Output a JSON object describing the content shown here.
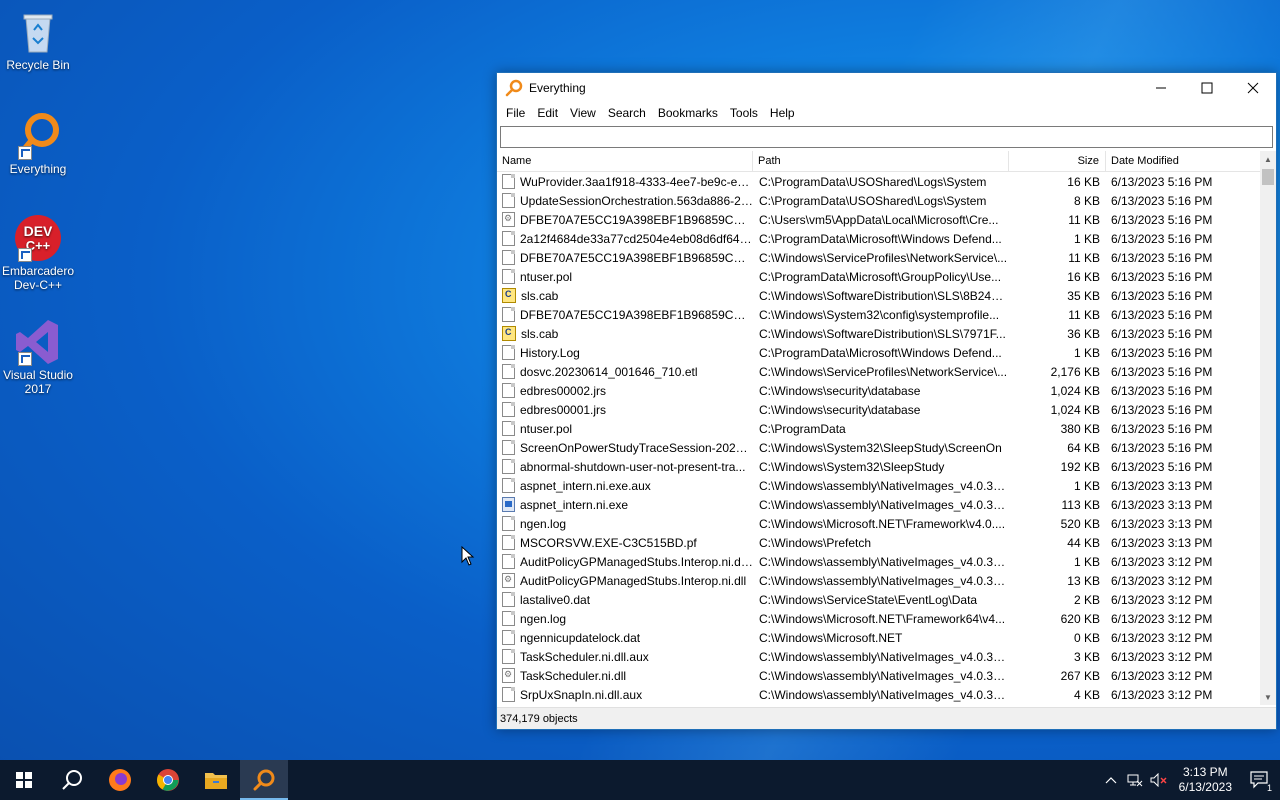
{
  "desktop": {
    "icons": [
      {
        "label": "Recycle Bin"
      },
      {
        "label": "Everything"
      },
      {
        "label": "Embarcadero Dev-C++"
      },
      {
        "label": "Visual Studio 2017"
      }
    ]
  },
  "window": {
    "title": "Everything",
    "menu": [
      "File",
      "Edit",
      "View",
      "Search",
      "Bookmarks",
      "Tools",
      "Help"
    ],
    "search": {
      "value": "",
      "placeholder": ""
    },
    "columns": {
      "name": "Name",
      "path": "Path",
      "size": "Size",
      "date": "Date Modified"
    },
    "rows": [
      {
        "icon": "doc-icon",
        "name": "WuProvider.3aa1f918-4333-4ee7-be9c-e5a...",
        "path": "C:\\ProgramData\\USOShared\\Logs\\System",
        "size": "16 KB",
        "date": "6/13/2023 5:16 PM"
      },
      {
        "icon": "doc-icon",
        "name": "UpdateSessionOrchestration.563da886-21...",
        "path": "C:\\ProgramData\\USOShared\\Logs\\System",
        "size": "8 KB",
        "date": "6/13/2023 5:16 PM"
      },
      {
        "icon": "dll-icon",
        "name": "DFBE70A7E5CC19A398EBF1B96859CE5D",
        "path": "C:\\Users\\vm5\\AppData\\Local\\Microsoft\\Cre...",
        "size": "11 KB",
        "date": "6/13/2023 5:16 PM"
      },
      {
        "icon": "doc-icon",
        "name": "2a12f4684de33a77cd2504e4eb08d6df649b...",
        "path": "C:\\ProgramData\\Microsoft\\Windows Defend...",
        "size": "1 KB",
        "date": "6/13/2023 5:16 PM"
      },
      {
        "icon": "doc-icon",
        "name": "DFBE70A7E5CC19A398EBF1B96859CE5D",
        "path": "C:\\Windows\\ServiceProfiles\\NetworkService\\...",
        "size": "11 KB",
        "date": "6/13/2023 5:16 PM"
      },
      {
        "icon": "doc-icon",
        "name": "ntuser.pol",
        "path": "C:\\ProgramData\\Microsoft\\GroupPolicy\\Use...",
        "size": "16 KB",
        "date": "6/13/2023 5:16 PM"
      },
      {
        "icon": "cab-icon",
        "name": "sls.cab",
        "path": "C:\\Windows\\SoftwareDistribution\\SLS\\8B24B...",
        "size": "35 KB",
        "date": "6/13/2023 5:16 PM"
      },
      {
        "icon": "doc-icon",
        "name": "DFBE70A7E5CC19A398EBF1B96859CE5D",
        "path": "C:\\Windows\\System32\\config\\systemprofile...",
        "size": "11 KB",
        "date": "6/13/2023 5:16 PM"
      },
      {
        "icon": "cab-icon",
        "name": "sls.cab",
        "path": "C:\\Windows\\SoftwareDistribution\\SLS\\7971F...",
        "size": "36 KB",
        "date": "6/13/2023 5:16 PM"
      },
      {
        "icon": "doc-icon",
        "name": "History.Log",
        "path": "C:\\ProgramData\\Microsoft\\Windows Defend...",
        "size": "1 KB",
        "date": "6/13/2023 5:16 PM"
      },
      {
        "icon": "doc-icon",
        "name": "dosvc.20230614_001646_710.etl",
        "path": "C:\\Windows\\ServiceProfiles\\NetworkService\\...",
        "size": "2,176 KB",
        "date": "6/13/2023 5:16 PM"
      },
      {
        "icon": "doc-icon",
        "name": "edbres00002.jrs",
        "path": "C:\\Windows\\security\\database",
        "size": "1,024 KB",
        "date": "6/13/2023 5:16 PM"
      },
      {
        "icon": "doc-icon",
        "name": "edbres00001.jrs",
        "path": "C:\\Windows\\security\\database",
        "size": "1,024 KB",
        "date": "6/13/2023 5:16 PM"
      },
      {
        "icon": "doc-icon",
        "name": "ntuser.pol",
        "path": "C:\\ProgramData",
        "size": "380 KB",
        "date": "6/13/2023 5:16 PM"
      },
      {
        "icon": "doc-icon",
        "name": "ScreenOnPowerStudyTraceSession-2023-0...",
        "path": "C:\\Windows\\System32\\SleepStudy\\ScreenOn",
        "size": "64 KB",
        "date": "6/13/2023 5:16 PM"
      },
      {
        "icon": "doc-icon",
        "name": "abnormal-shutdown-user-not-present-tra...",
        "path": "C:\\Windows\\System32\\SleepStudy",
        "size": "192 KB",
        "date": "6/13/2023 5:16 PM"
      },
      {
        "icon": "doc-icon",
        "name": "aspnet_intern.ni.exe.aux",
        "path": "C:\\Windows\\assembly\\NativeImages_v4.0.30...",
        "size": "1 KB",
        "date": "6/13/2023 3:13 PM"
      },
      {
        "icon": "exe-icon",
        "name": "aspnet_intern.ni.exe",
        "path": "C:\\Windows\\assembly\\NativeImages_v4.0.30...",
        "size": "113 KB",
        "date": "6/13/2023 3:13 PM"
      },
      {
        "icon": "doc-icon",
        "name": "ngen.log",
        "path": "C:\\Windows\\Microsoft.NET\\Framework\\v4.0....",
        "size": "520 KB",
        "date": "6/13/2023 3:13 PM"
      },
      {
        "icon": "doc-icon",
        "name": "MSCORSVW.EXE-C3C515BD.pf",
        "path": "C:\\Windows\\Prefetch",
        "size": "44 KB",
        "date": "6/13/2023 3:13 PM"
      },
      {
        "icon": "doc-icon",
        "name": "AuditPolicyGPManagedStubs.Interop.ni.dl...",
        "path": "C:\\Windows\\assembly\\NativeImages_v4.0.30...",
        "size": "1 KB",
        "date": "6/13/2023 3:12 PM"
      },
      {
        "icon": "dll-icon",
        "name": "AuditPolicyGPManagedStubs.Interop.ni.dll",
        "path": "C:\\Windows\\assembly\\NativeImages_v4.0.30...",
        "size": "13 KB",
        "date": "6/13/2023 3:12 PM"
      },
      {
        "icon": "doc-icon",
        "name": "lastalive0.dat",
        "path": "C:\\Windows\\ServiceState\\EventLog\\Data",
        "size": "2 KB",
        "date": "6/13/2023 3:12 PM"
      },
      {
        "icon": "doc-icon",
        "name": "ngen.log",
        "path": "C:\\Windows\\Microsoft.NET\\Framework64\\v4...",
        "size": "620 KB",
        "date": "6/13/2023 3:12 PM"
      },
      {
        "icon": "doc-icon",
        "name": "ngennicupdatelock.dat",
        "path": "C:\\Windows\\Microsoft.NET",
        "size": "0 KB",
        "date": "6/13/2023 3:12 PM"
      },
      {
        "icon": "doc-icon",
        "name": "TaskScheduler.ni.dll.aux",
        "path": "C:\\Windows\\assembly\\NativeImages_v4.0.30...",
        "size": "3 KB",
        "date": "6/13/2023 3:12 PM"
      },
      {
        "icon": "dll-icon",
        "name": "TaskScheduler.ni.dll",
        "path": "C:\\Windows\\assembly\\NativeImages_v4.0.30...",
        "size": "267 KB",
        "date": "6/13/2023 3:12 PM"
      },
      {
        "icon": "doc-icon",
        "name": "SrpUxSnapIn.ni.dll.aux",
        "path": "C:\\Windows\\assembly\\NativeImages_v4.0.30...",
        "size": "4 KB",
        "date": "6/13/2023 3:12 PM"
      }
    ],
    "status": "374,179 objects"
  },
  "taskbar": {
    "clock_time": "3:13 PM",
    "clock_date": "6/13/2023",
    "notification_count": "1"
  }
}
